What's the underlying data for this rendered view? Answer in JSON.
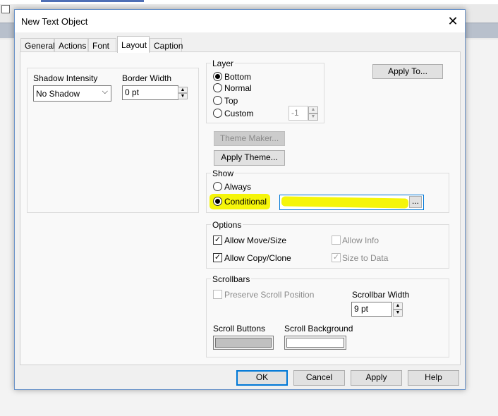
{
  "window": {
    "title": "New Text Object"
  },
  "tabs": [
    "General",
    "Actions",
    "Font",
    "Layout",
    "Caption"
  ],
  "layout": {
    "shadow_intensity_label": "Shadow Intensity",
    "shadow_intensity_value": "No Shadow",
    "border_width_label": "Border Width",
    "border_width_value": "0 pt"
  },
  "layer": {
    "label": "Layer",
    "options": [
      "Bottom",
      "Normal",
      "Top",
      "Custom"
    ],
    "selected": "Bottom",
    "custom_value": "-1"
  },
  "buttons": {
    "apply_to": "Apply To...",
    "theme_maker": "Theme Maker...",
    "apply_theme": "Apply Theme...",
    "ellipsis": "...",
    "ok": "OK",
    "cancel": "Cancel",
    "apply": "Apply",
    "help": "Help"
  },
  "show": {
    "label": "Show",
    "options": [
      "Always",
      "Conditional"
    ],
    "selected": "Conditional"
  },
  "options": {
    "label": "Options",
    "allow_move_size": "Allow Move/Size",
    "allow_copy_clone": "Allow Copy/Clone",
    "allow_info": "Allow Info",
    "size_to_data": "Size to Data"
  },
  "scrollbars": {
    "label": "Scrollbars",
    "preserve_scroll_position": "Preserve Scroll Position",
    "scrollbar_width_label": "Scrollbar Width",
    "scrollbar_width_value": "9 pt",
    "scroll_buttons_label": "Scroll Buttons",
    "scroll_background_label": "Scroll Background",
    "scroll_buttons_color": "#c0c0c0",
    "scroll_background_color": "#ffffff"
  },
  "colors": {
    "highlight": "#f5f50a",
    "accent": "#0078d7"
  }
}
